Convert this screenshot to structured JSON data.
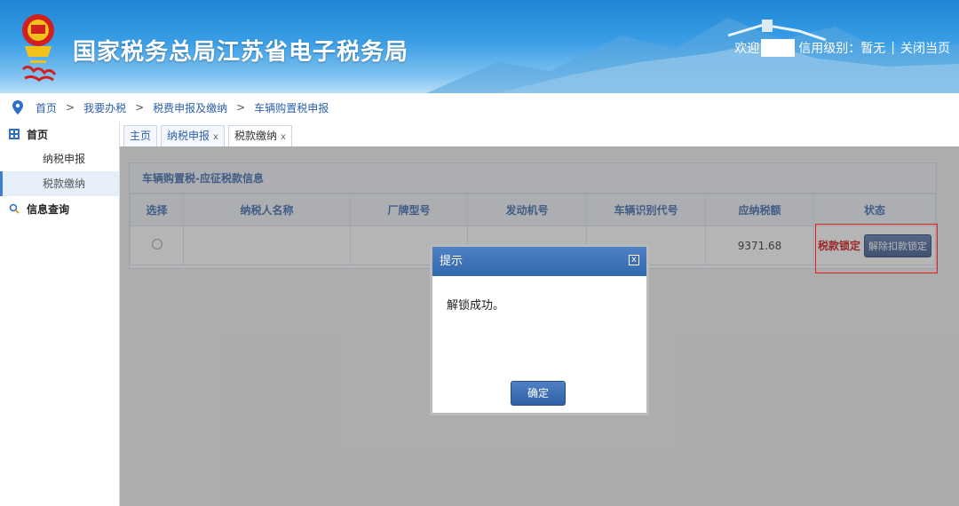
{
  "header": {
    "site_title": "国家税务总局江苏省电子税务局",
    "welcome": "欢迎",
    "credit_level": "信用级别：暂无",
    "separator": "|",
    "close_page": "关闭当页"
  },
  "breadcrumb": [
    "首页",
    "我要办税",
    "税费申报及缴纳",
    "车辆购置税申报"
  ],
  "breadcrumb_arrow": ">",
  "sidebar": {
    "home": "首页",
    "items": [
      "纳税申报",
      "税款缴纳"
    ],
    "info_query": "信息查询"
  },
  "tabs": [
    {
      "label": "主页",
      "closable": false
    },
    {
      "label": "纳税申报",
      "closable": true
    },
    {
      "label": "税款缴纳",
      "closable": true
    }
  ],
  "tab_close": "x",
  "panel": {
    "title": "车辆购置税-应征税款信息",
    "columns": [
      "选择",
      "纳税人名称",
      "厂牌型号",
      "发动机号",
      "车辆识别代号",
      "应纳税额",
      "状态"
    ],
    "row": {
      "tax_amount": "9371.68",
      "status_text": "税款锁定",
      "unlock_button": "解除扣款锁定"
    }
  },
  "dialog": {
    "title": "提示",
    "close": "x",
    "message": "解锁成功。",
    "ok": "确定"
  },
  "colors": {
    "brand_blue": "#2c5fa8",
    "status_red": "#cc0000",
    "highlight": "#e02020"
  }
}
